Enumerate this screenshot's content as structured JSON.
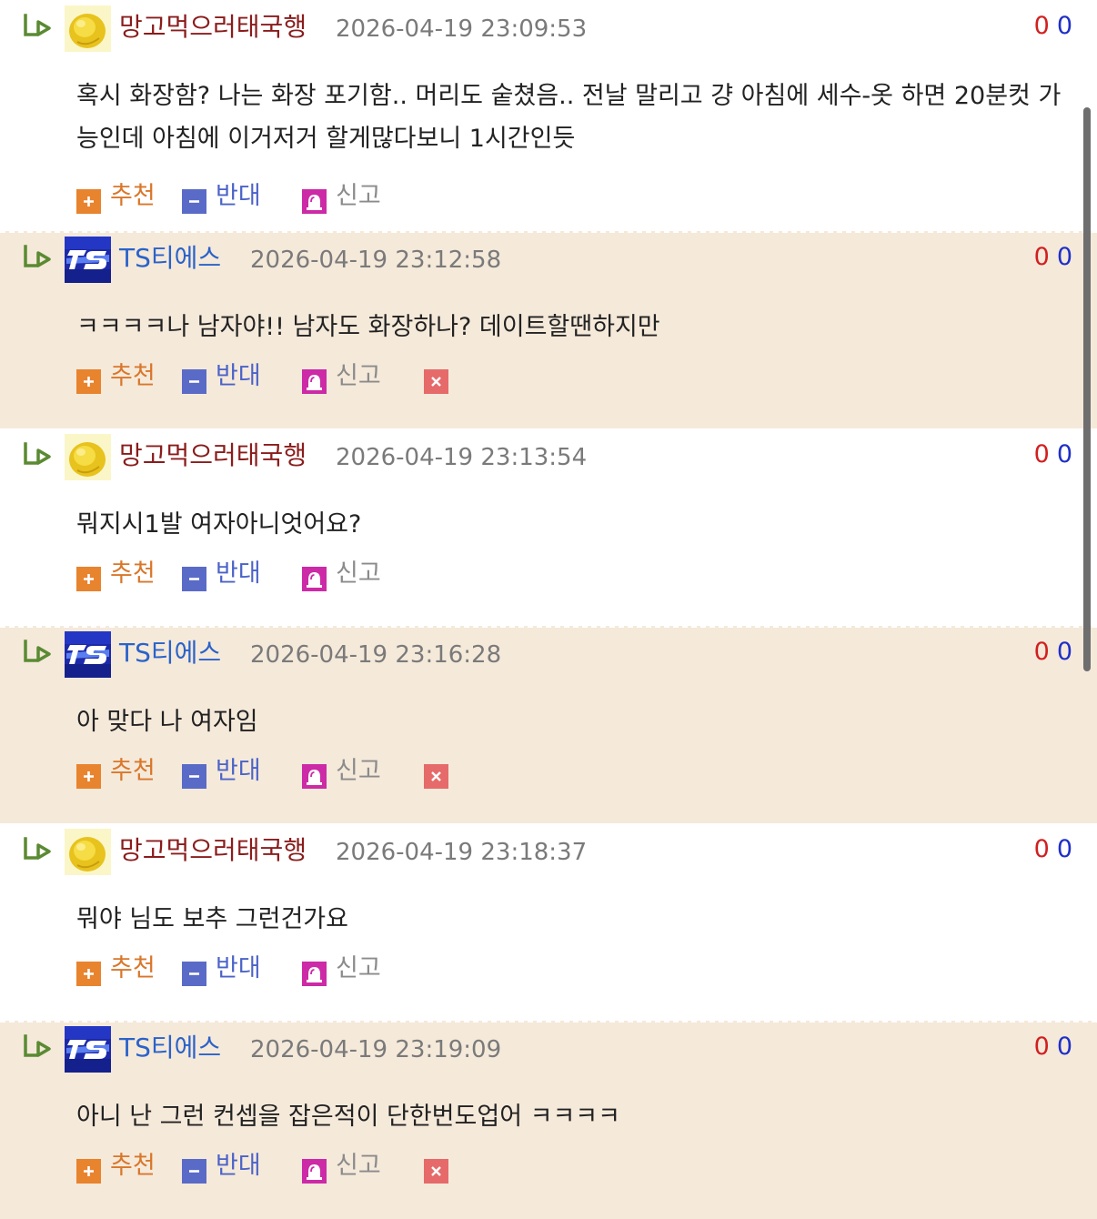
{
  "actions": {
    "recommend": "추천",
    "oppose": "반대",
    "report": "신고"
  },
  "comments": [
    {
      "author": "망고먹으러태국행",
      "datetime": "2026-04-19 23:09:53",
      "up": "0",
      "down": "0",
      "text": "혹시 화장함? 나는 화장 포기함.. 머리도 숱쳤음.. 전날 말리고 걍 아침에 세수-옷 하면 20분컷 가능인데 아침에 이거저거 할게많다보니 1시간인듯"
    },
    {
      "author": "TS티에스",
      "datetime": "2026-04-19 23:12:58",
      "up": "0",
      "down": "0",
      "text": "ㅋㅋㅋㅋ나 남자야!! 남자도 화장하나? 데이트할땐하지만"
    },
    {
      "author": "망고먹으러태국행",
      "datetime": "2026-04-19 23:13:54",
      "up": "0",
      "down": "0",
      "text": "뭐지시1발 여자아니엇어요?"
    },
    {
      "author": "TS티에스",
      "datetime": "2026-04-19 23:16:28",
      "up": "0",
      "down": "0",
      "text": "아 맞다 나 여자임"
    },
    {
      "author": "망고먹으러태국행",
      "datetime": "2026-04-19 23:18:37",
      "up": "0",
      "down": "0",
      "text": "뭐야 님도 보추 그런건가요"
    },
    {
      "author": "TS티에스",
      "datetime": "2026-04-19 23:19:09",
      "up": "0",
      "down": "0",
      "text": "아니 난 그런 컨셉을 잡은적이 단한번도업어 ㅋㅋㅋㅋ"
    }
  ],
  "colors": {
    "beige_row": "#f5e9da",
    "author_mango": "#8a1c1c",
    "author_ts": "#2a62c9",
    "upvote": "#d21f1f",
    "downvote": "#1f2fc8"
  },
  "icons": {
    "reply": "reply-arrow-icon",
    "recommend": "plus-icon",
    "oppose": "minus-icon",
    "report": "siren-icon",
    "delete": "close-icon"
  }
}
